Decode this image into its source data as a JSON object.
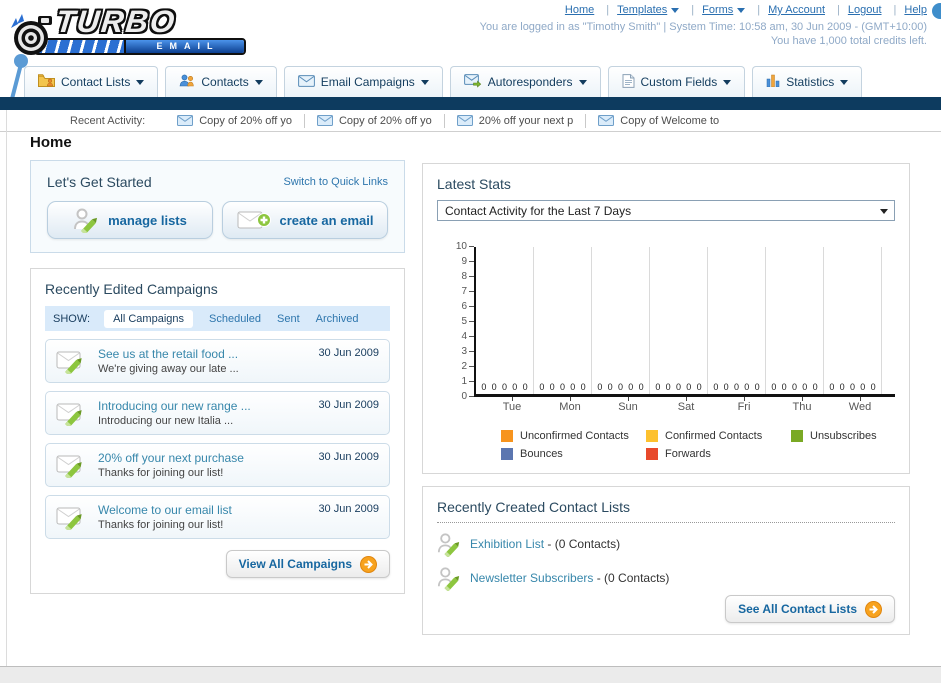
{
  "brand": {
    "name_top": "TURBO",
    "name_bottom": "EMAIL"
  },
  "header": {
    "nav": [
      {
        "label": "Home",
        "dropdown": false
      },
      {
        "label": "Templates",
        "dropdown": true
      },
      {
        "label": "Forms",
        "dropdown": true
      },
      {
        "label": "My Account",
        "dropdown": false
      },
      {
        "label": "Logout",
        "dropdown": false
      },
      {
        "label": "Help",
        "dropdown": false
      }
    ],
    "login_info": "You are logged in as \"Timothy Smith\" | System Time: 10:58 am, 30 Jun 2009 - (GMT+10:00)",
    "credits": "You have 1,000 total credits left."
  },
  "tabs": [
    {
      "label": "Contact Lists",
      "icon": "contact-lists-folder-icon"
    },
    {
      "label": "Contacts",
      "icon": "contacts-people-icon"
    },
    {
      "label": "Email Campaigns",
      "icon": "email-envelope-icon"
    },
    {
      "label": "Autoresponders",
      "icon": "autoresponder-envelope-icon"
    },
    {
      "label": "Custom Fields",
      "icon": "custom-fields-page-icon"
    },
    {
      "label": "Statistics",
      "icon": "statistics-bars-icon"
    }
  ],
  "recent_activity": {
    "label": "Recent Activity:",
    "items": [
      "Copy of 20% off yo",
      "Copy of 20% off yo",
      "20% off your next p",
      "Copy of Welcome to"
    ]
  },
  "page_title": "Home",
  "get_started": {
    "title": "Let's Get Started",
    "switch_link": "Switch to Quick Links",
    "buttons": [
      {
        "label": "manage lists"
      },
      {
        "label": "create an email"
      }
    ]
  },
  "campaigns": {
    "title": "Recently Edited Campaigns",
    "show_label": "SHOW:",
    "filters": [
      "All Campaigns",
      "Scheduled",
      "Sent",
      "Archived"
    ],
    "active_filter": "All Campaigns",
    "items": [
      {
        "title": "See us at the retail food ...",
        "subtitle": "We're giving away our late ...",
        "date": "30 Jun 2009"
      },
      {
        "title": "Introducing our new range ...",
        "subtitle": "Introducing our new Italia ...",
        "date": "30 Jun 2009"
      },
      {
        "title": "20% off your next purchase",
        "subtitle": "Thanks for joining our list!",
        "date": "30 Jun 2009"
      },
      {
        "title": "Welcome to our email list",
        "subtitle": "Thanks for joining our list!",
        "date": "30 Jun 2009"
      }
    ],
    "view_all_label": "View All Campaigns"
  },
  "stats": {
    "title": "Latest Stats",
    "dropdown_value": "Contact Activity for the Last 7 Days"
  },
  "chart_data": {
    "type": "bar",
    "title": "Contact Activity for the Last 7 Days",
    "categories": [
      "Tue",
      "Mon",
      "Sun",
      "Sat",
      "Fri",
      "Thu",
      "Wed"
    ],
    "series": [
      {
        "name": "Unconfirmed Contacts",
        "color": "#f7941e",
        "values": [
          0,
          0,
          0,
          0,
          0,
          0,
          0
        ]
      },
      {
        "name": "Confirmed Contacts",
        "color": "#fdc12e",
        "values": [
          0,
          0,
          0,
          0,
          0,
          0,
          0
        ]
      },
      {
        "name": "Unsubscribes",
        "color": "#7aa924",
        "values": [
          0,
          0,
          0,
          0,
          0,
          0,
          0
        ]
      },
      {
        "name": "Bounces",
        "color": "#5b76b0",
        "values": [
          0,
          0,
          0,
          0,
          0,
          0,
          0
        ]
      },
      {
        "name": "Forwards",
        "color": "#e8492b",
        "values": [
          0,
          0,
          0,
          0,
          0,
          0,
          0
        ]
      }
    ],
    "ylim": [
      0,
      10
    ],
    "ytick_step": 1,
    "grid": true,
    "legend_position": "bottom",
    "value_label_shown_per_point": "0"
  },
  "contact_lists": {
    "title": "Recently Created Contact Lists",
    "items": [
      {
        "name": "Exhibition List",
        "detail": "- (0 Contacts)"
      },
      {
        "name": "Newsletter Subscribers",
        "detail": "- (0 Contacts)"
      }
    ],
    "see_all_label": "See All Contact Lists"
  }
}
